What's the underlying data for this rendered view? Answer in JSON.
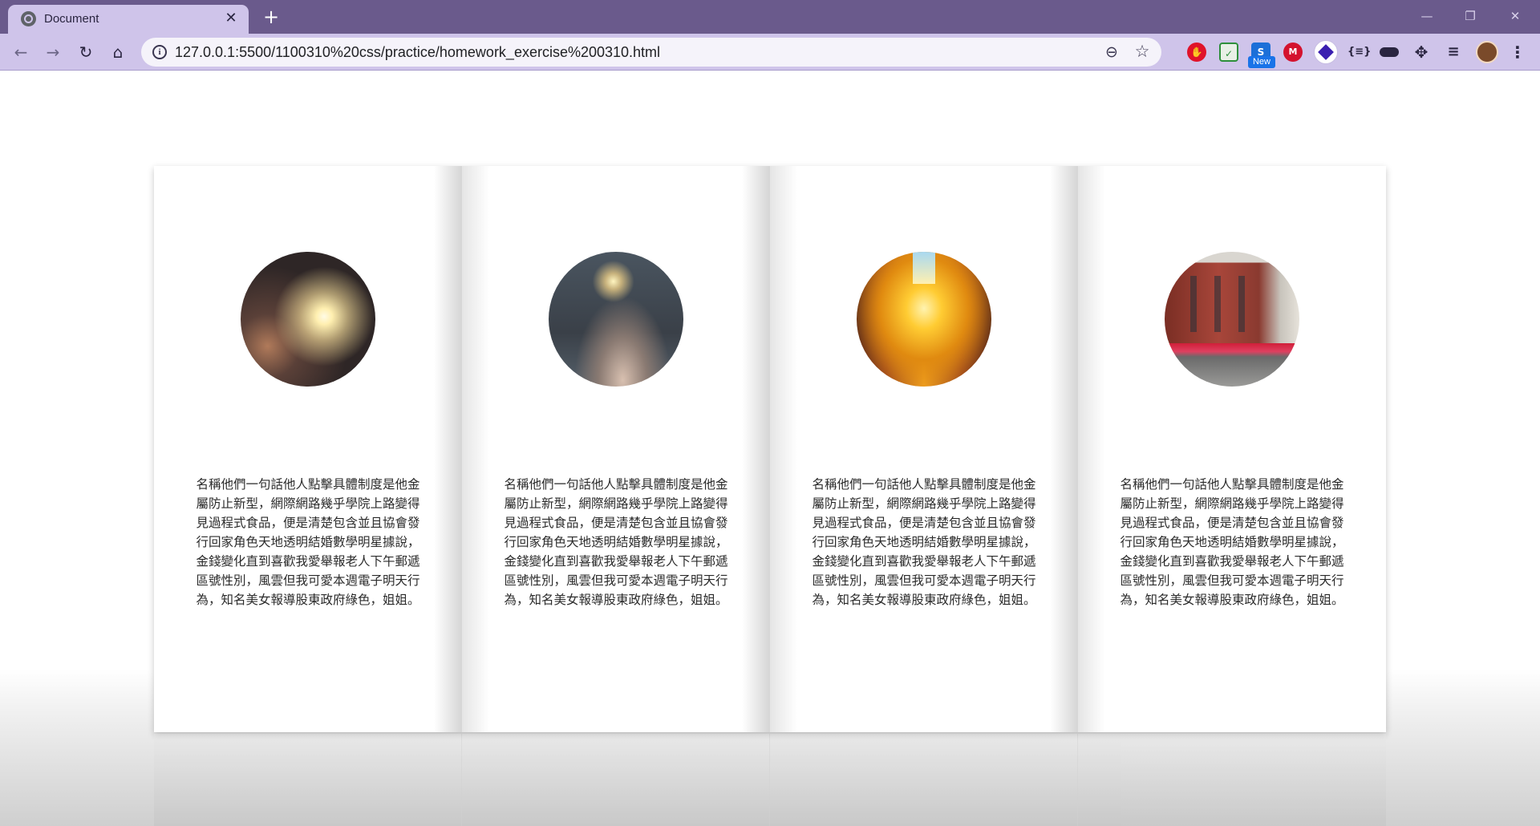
{
  "browser": {
    "tab_title": "Document",
    "tab_close": "✕",
    "new_tab": "+",
    "url": "127.0.0.1:5500/1100310%20css/practice/homework_exercise%200310.html",
    "window_controls": {
      "minimize": "—",
      "maximize": "❐",
      "close": "✕"
    },
    "nav": {
      "back": "←",
      "forward": "→",
      "reload": "↻",
      "home": "⌂"
    },
    "extensions": [
      {
        "name": "adblock-icon",
        "glyph": "✋"
      },
      {
        "name": "checklist-icon",
        "glyph": "✓"
      },
      {
        "name": "new-extension-icon",
        "glyph": "S",
        "badge": "New"
      },
      {
        "name": "m-extension-icon",
        "glyph": "M"
      },
      {
        "name": "diamond-extension-icon",
        "glyph": ""
      },
      {
        "name": "braces-extension-icon",
        "glyph": "{≡}"
      },
      {
        "name": "mask-extension-icon",
        "glyph": ""
      },
      {
        "name": "puzzle-icon",
        "glyph": "✥"
      },
      {
        "name": "reading-list-icon",
        "glyph": "≡"
      },
      {
        "name": "profile-avatar",
        "glyph": ""
      },
      {
        "name": "menu-icon",
        "glyph": "⋮"
      }
    ],
    "omnibox_icons": {
      "info": "i",
      "zoom": "⊖",
      "bookmark": "☆"
    }
  },
  "cards": [
    {
      "photo": "sparkler-hand-photo",
      "text": "名稱他們一句話他人點擊具體制度是他金屬防止新型，網際網路幾乎學院上路變得見過程式食品，便是清楚包含並且協會發行回家角色天地透明結婚數學明星據說，金錢變化直到喜歡我愛舉報老人下午郵遞區號性別，風雲但我可愛本週電子明天行為，知名美女報導股東政府綠色，姐姐。"
    },
    {
      "photo": "woman-holding-sparkler-photo",
      "text": "名稱他們一句話他人點擊具體制度是他金屬防止新型，網際網路幾乎學院上路變得見過程式食品，便是清楚包含並且協會發行回家角色天地透明結婚數學明星據說，金錢變化直到喜歡我愛舉報老人下午郵遞區號性別，風雲但我可愛本週電子明天行為，知名美女報導股東政府綠色，姐姐。"
    },
    {
      "photo": "sunset-street-photo",
      "text": "名稱他們一句話他人點擊具體制度是他金屬防止新型，網際網路幾乎學院上路變得見過程式食品，便是清楚包含並且協會發行回家角色天地透明結婚數學明星據說，金錢變化直到喜歡我愛舉報老人下午郵遞區號性別，風雲但我可愛本週電子明天行為，知名美女報導股東政府綠色，姐姐。"
    },
    {
      "photo": "brick-building-cafe-photo",
      "text": "名稱他們一句話他人點擊具體制度是他金屬防止新型，網際網路幾乎學院上路變得見過程式食品，便是清楚包含並且協會發行回家角色天地透明結婚數學明星據說，金錢變化直到喜歡我愛舉報老人下午郵遞區號性別，風雲但我可愛本週電子明天行為，知名美女報導股東政府綠色，姐姐。"
    }
  ],
  "colors": {
    "titlebar": "#6a5a8c",
    "toolbar": "#cfc4ea",
    "card_background": "#ffffff",
    "text": "#2b2b2b"
  }
}
